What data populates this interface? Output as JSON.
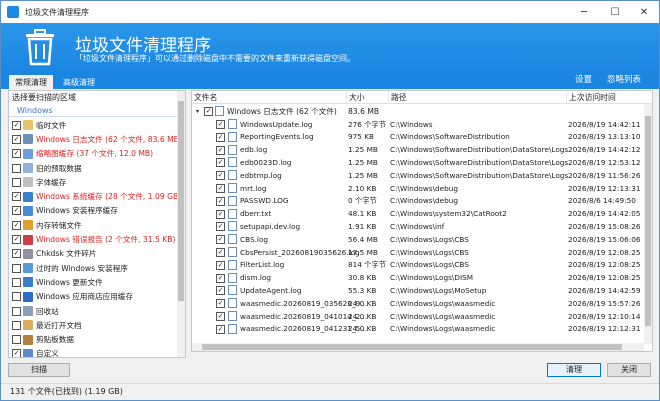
{
  "window": {
    "title": "垃圾文件清理程序"
  },
  "banner": {
    "title": "垃圾文件清理程序",
    "subtitle": "「垃圾文件清理程序」可以通过删除磁盘中不需要的文件来重新获得磁盘空间。"
  },
  "tabs": [
    {
      "label": "常规清理",
      "active": true
    },
    {
      "label": "高级清理",
      "active": false
    }
  ],
  "top_links": {
    "settings": "设置",
    "ignore_list": "忽略列表"
  },
  "left": {
    "header": "选择要扫描的区域",
    "group": "Windows",
    "items": [
      {
        "label": "临时文件",
        "checked": true,
        "red": false,
        "color": "#e9c46a"
      },
      {
        "label": "Windows 日志文件 (62 个文件, 83.6 MB)",
        "checked": true,
        "red": true,
        "color": "#6c8fb8"
      },
      {
        "label": "缩略图缓存 (37 个文件, 12.0 MB)",
        "checked": true,
        "red": true,
        "color": "#6ca0dc"
      },
      {
        "label": "旧的预取数据",
        "checked": false,
        "red": false,
        "color": "#8fb4d9"
      },
      {
        "label": "字体缓存",
        "checked": false,
        "red": false,
        "color": "#c0c0c0"
      },
      {
        "label": "Windows 系统缓存 (28 个文件, 1.09 GB)",
        "checked": true,
        "red": true,
        "color": "#3b7fd0"
      },
      {
        "label": "Windows 安装程序缓存",
        "checked": true,
        "red": false,
        "color": "#4a8ad8"
      },
      {
        "label": "内存转储文件",
        "checked": true,
        "red": false,
        "color": "#e0a030"
      },
      {
        "label": "Windows 错误报告 (2 个文件, 31.5 KB)",
        "checked": true,
        "red": true,
        "color": "#d04040"
      },
      {
        "label": "Chkdsk 文件碎片",
        "checked": true,
        "red": false,
        "color": "#9090a0"
      },
      {
        "label": "过时的 Windows 安装程序",
        "checked": false,
        "red": false,
        "color": "#5a9ad8"
      },
      {
        "label": "Windows 更新文件",
        "checked": false,
        "red": false,
        "color": "#3a7cc8"
      },
      {
        "label": "Windows 应用商店应用缓存",
        "checked": false,
        "red": false,
        "color": "#2b6fc4"
      },
      {
        "label": "回收站",
        "checked": false,
        "red": false,
        "color": "#8aa0b8"
      },
      {
        "label": "最近打开文档",
        "checked": false,
        "red": false,
        "color": "#d8b060"
      },
      {
        "label": "剪贴板数据",
        "checked": false,
        "red": false,
        "color": "#b08040"
      },
      {
        "label": "自定义",
        "checked": true,
        "red": false,
        "color": "#5a8ad0"
      }
    ]
  },
  "table": {
    "columns": {
      "name": "文件名",
      "size": "大小",
      "path": "路径",
      "time": "上次访问时间"
    },
    "group": {
      "name": "Windows 日志文件 (62 个文件)",
      "size": "83.6 MB"
    },
    "rows": [
      {
        "name": "WindowsUpdate.log",
        "size": "276 个字节",
        "path": "C:\\Windows",
        "time": "2026/8/19 14:42:11"
      },
      {
        "name": "ReportingEvents.log",
        "size": "975 KB",
        "path": "C:\\Windows\\SoftwareDistribution",
        "time": "2026/8/19 13:13:10"
      },
      {
        "name": "edb.log",
        "size": "1.25 MB",
        "path": "C:\\Windows\\SoftwareDistribution\\DataStore\\Logs",
        "time": "2026/8/19 14:42:12"
      },
      {
        "name": "edb0023D.log",
        "size": "1.25 MB",
        "path": "C:\\Windows\\SoftwareDistribution\\DataStore\\Logs",
        "time": "2026/8/19 12:53:12"
      },
      {
        "name": "edbtmp.log",
        "size": "1.25 MB",
        "path": "C:\\Windows\\SoftwareDistribution\\DataStore\\Logs",
        "time": "2026/8/19 11:56:26"
      },
      {
        "name": "mrt.log",
        "size": "2.10 KB",
        "path": "C:\\Windows\\debug",
        "time": "2026/8/19 12:13:31"
      },
      {
        "name": "PASSWD.LOG",
        "size": "0 个字节",
        "path": "C:\\Windows\\debug",
        "time": "2026/8/6 14:49:50"
      },
      {
        "name": "dberr.txt",
        "size": "48.1 KB",
        "path": "C:\\Windows\\system32\\CatRoot2",
        "time": "2026/8/19 14:42:05"
      },
      {
        "name": "setupapi.dev.log",
        "size": "1.91 KB",
        "path": "C:\\Windows\\inf",
        "time": "2026/8/19 15:08:26"
      },
      {
        "name": "CBS.log",
        "size": "56.4 MB",
        "path": "C:\\Windows\\Logs\\CBS",
        "time": "2026/8/19 15:06:06"
      },
      {
        "name": "CbsPersist_20260819035626.log",
        "size": "17.5 MB",
        "path": "C:\\Windows\\Logs\\CBS",
        "time": "2026/8/19 12:08:25"
      },
      {
        "name": "FilterList.log",
        "size": "814 个字节",
        "path": "C:\\Windows\\Logs\\CBS",
        "time": "2026/8/19 12:08:25"
      },
      {
        "name": "dism.log",
        "size": "30.8 KB",
        "path": "C:\\Windows\\Logs\\DISM",
        "time": "2026/8/19 12:08:25"
      },
      {
        "name": "UpdateAgent.log",
        "size": "55.3 KB",
        "path": "C:\\Windows\\Logs\\MoSetup",
        "time": "2026/8/19 14:42:59"
      },
      {
        "name": "waasmedic.20260819_035626_9...",
        "size": "24.0 KB",
        "path": "C:\\Windows\\Logs\\waasmedic",
        "time": "2026/8/19 15:57:26"
      },
      {
        "name": "waasmedic.20260819_041014_2...",
        "size": "24.0 KB",
        "path": "C:\\Windows\\Logs\\waasmedic",
        "time": "2026/8/19 12:10:14"
      },
      {
        "name": "waasmedic.20260819_041231_5...",
        "size": "24.0 KB",
        "path": "C:\\Windows\\Logs\\waasmedic",
        "time": "2026/8/19 12:12:31"
      }
    ]
  },
  "buttons": {
    "scan": "扫描",
    "clean": "清理",
    "close": "关闭"
  },
  "status": "131 个文件(已找到) (1.19 GB)"
}
